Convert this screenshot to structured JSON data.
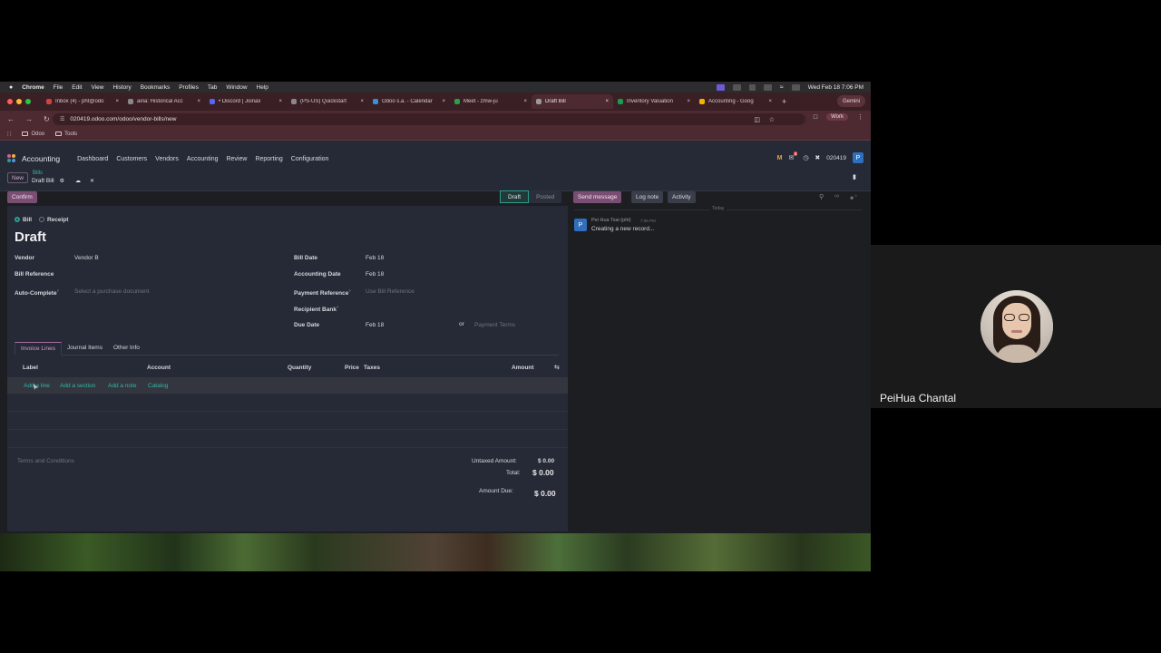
{
  "mac": {
    "app": "Chrome",
    "menus": [
      "File",
      "Edit",
      "View",
      "History",
      "Bookmarks",
      "Profiles",
      "Tab",
      "Window",
      "Help"
    ],
    "datetime": "Wed Feb 18  7:06 PM"
  },
  "tabs": [
    {
      "title": "Inbox (4) - pht@odo",
      "color": "#c44"
    },
    {
      "title": "airia: Historical Acc",
      "color": "#888"
    },
    {
      "title": "• Discord | Joinax",
      "color": "#5865f2"
    },
    {
      "title": "(PS-US) Quickstart",
      "color": "#888"
    },
    {
      "title": "Odoo s.a. - Calendar",
      "color": "#3a8fd9"
    },
    {
      "title": "Meet - zmw-ju",
      "color": "#2aa04a"
    },
    {
      "title": "Draft Bill",
      "color": "#999"
    },
    {
      "title": "Inventory Valuation",
      "color": "#1a9d52"
    },
    {
      "title": "Accounting - Goog",
      "color": "#f2b400"
    }
  ],
  "gemini_label": "Gemini",
  "url": "020419.odoo.com/odoo/vendor-bills/new",
  "profile_label": "Work",
  "bookmarks": [
    "Odoo",
    "Tools"
  ],
  "odoo": {
    "app_name": "Accounting",
    "menus": [
      "Dashboard",
      "Customers",
      "Vendors",
      "Accounting",
      "Review",
      "Reporting",
      "Configuration"
    ],
    "db_name": "020419",
    "user_initial": "P",
    "chat_badge": "4"
  },
  "breadcrumb": {
    "new_label": "New",
    "parent": "Bills",
    "current": "Draft Bill"
  },
  "form": {
    "confirm_label": "Confirm",
    "status": [
      "Draft",
      "Posted"
    ],
    "type_options": [
      "Bill",
      "Receipt"
    ],
    "title": "Draft",
    "vendor_label": "Vendor",
    "vendor_value": "Vendor B",
    "bill_ref_label": "Bill Reference",
    "autocomplete_label": "Auto-Complete",
    "autocomplete_placeholder": "Select a purchase document",
    "bill_date_label": "Bill Date",
    "bill_date_value": "Feb 18",
    "acc_date_label": "Accounting Date",
    "acc_date_value": "Feb 18",
    "pay_ref_label": "Payment Reference",
    "pay_ref_placeholder": "Use Bill Reference",
    "recipient_label": "Recipient Bank",
    "due_label": "Due Date",
    "due_value": "Feb 18",
    "or_text": "or",
    "payment_terms_placeholder": "Payment Terms",
    "notebook_tabs": [
      "Invoice Lines",
      "Journal Items",
      "Other Info"
    ],
    "columns": [
      "Label",
      "Account",
      "Quantity",
      "Price",
      "Taxes",
      "Amount"
    ],
    "add_links": [
      "Add a line",
      "Add a section",
      "Add a note",
      "Catalog"
    ],
    "terms_placeholder": "Terms and Conditions",
    "untaxed_label": "Untaxed Amount:",
    "untaxed_value": "$ 0.00",
    "total_label": "Total:",
    "total_value": "$ 0.00",
    "due_amount_label": "Amount Due:",
    "due_amount_value": "$ 0.00"
  },
  "chatter": {
    "send_label": "Send message",
    "log_label": "Log note",
    "activity_label": "Activity",
    "follower_count": "0",
    "today_label": "Today",
    "author": "Pei Hua Tsai (pht)",
    "time": "7:06 PM",
    "message": "Creating a new record...",
    "avatar_initial": "P"
  },
  "video": {
    "participant": "PeiHua Chantal"
  }
}
